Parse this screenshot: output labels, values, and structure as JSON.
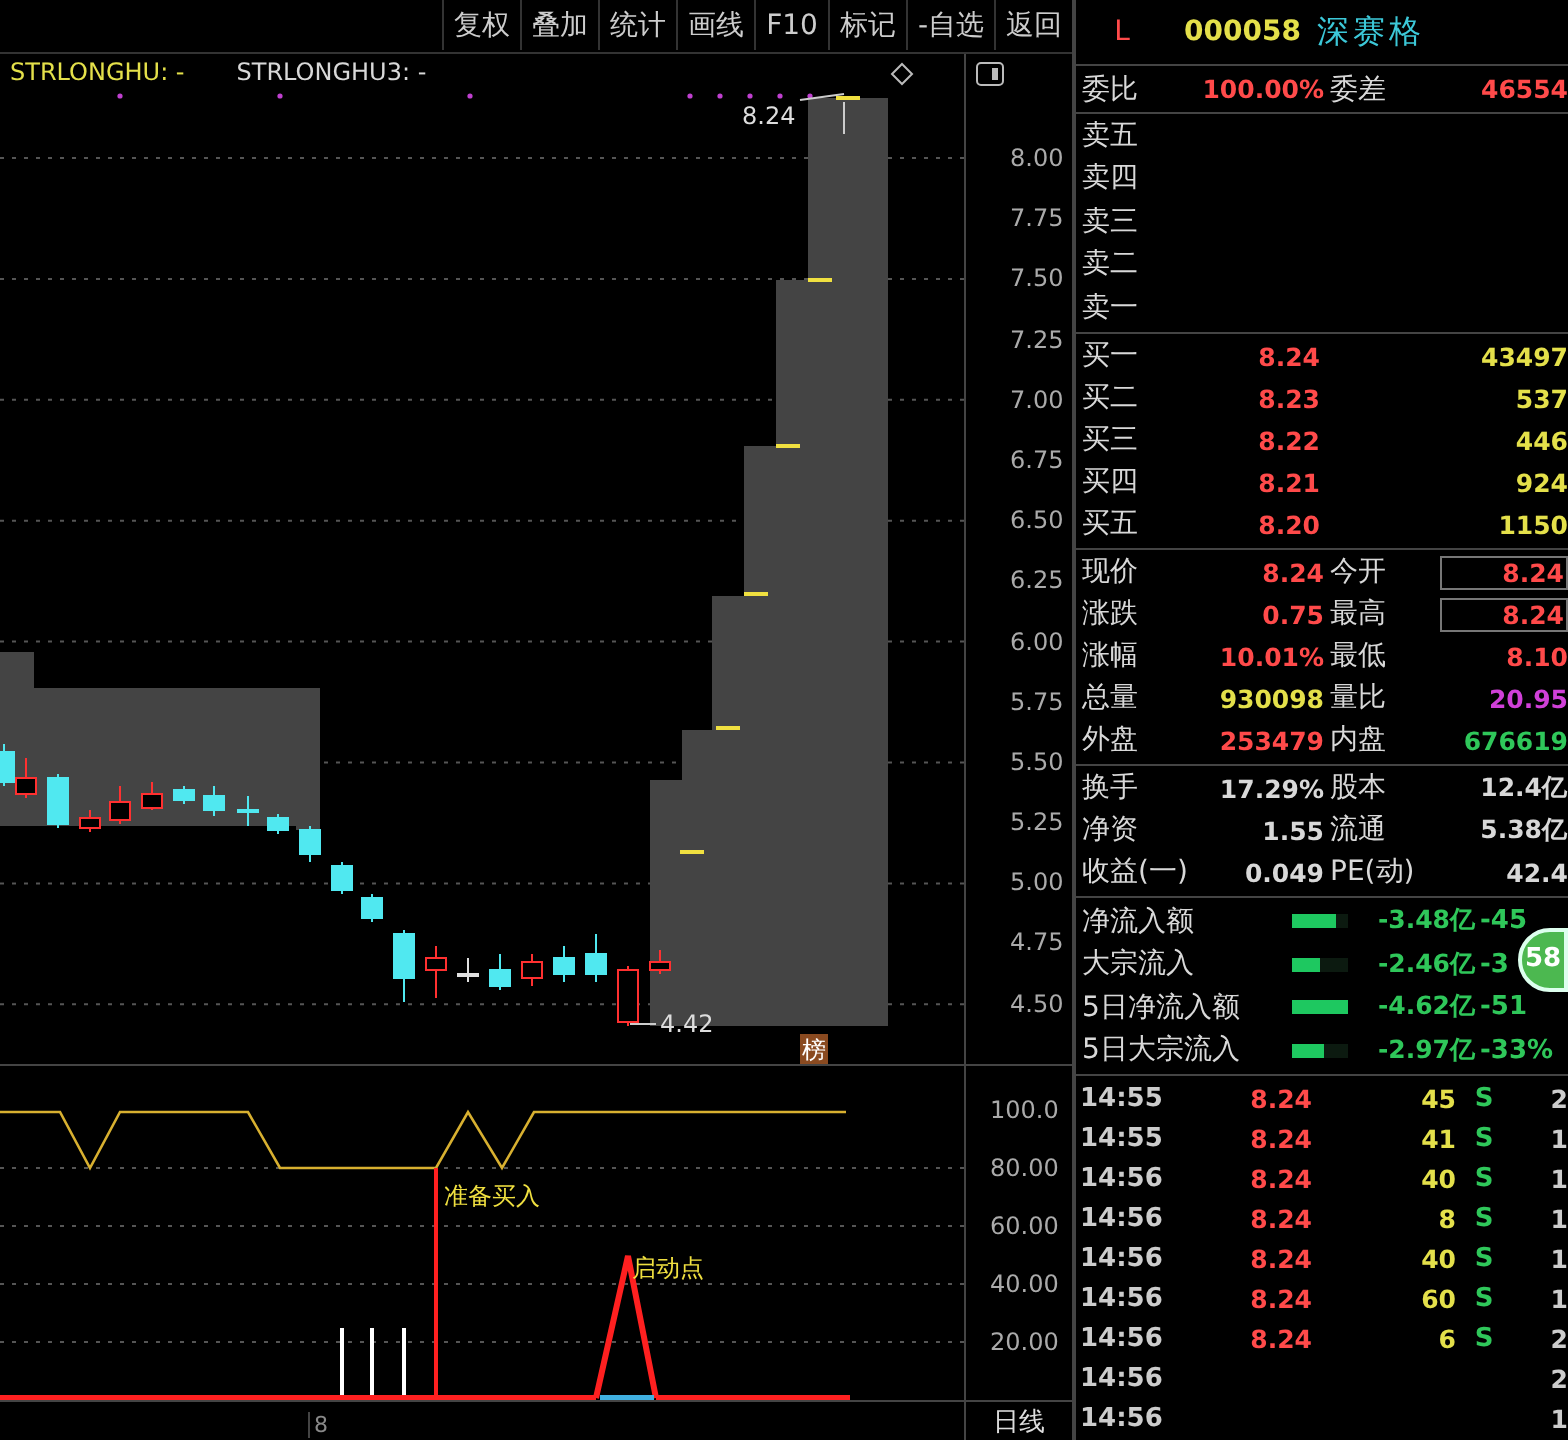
{
  "toolbar": {
    "buttons": [
      "复权",
      "叠加",
      "统计",
      "画线",
      "F10",
      "标记",
      "-自选",
      "返回"
    ]
  },
  "chart": {
    "legend": [
      {
        "text": "STRLONGHU: -",
        "color": "#e4e04a"
      },
      {
        "text": "STRLONGHU3: -",
        "color": "#d8d8d8"
      }
    ],
    "high_label": "8.24",
    "low_label": "4.42",
    "badge": "榜",
    "price_axis": [
      "8.00",
      "7.75",
      "7.50",
      "7.25",
      "7.00",
      "6.75",
      "6.50",
      "6.25",
      "6.00",
      "5.75",
      "5.50",
      "5.25",
      "5.00",
      "4.75",
      "4.50"
    ]
  },
  "indicator": {
    "axis": [
      "100.0",
      "80.00",
      "60.00",
      "40.00",
      "20.00"
    ],
    "buy_signal": "准备买入",
    "start_signal": "启动点"
  },
  "time_axis": {
    "tick": "8",
    "period_tab": "日线"
  },
  "quote": {
    "market": "L",
    "code": "000058",
    "name": "深赛格",
    "ratio": {
      "label": "委比",
      "value": "100.00%",
      "label2": "委差",
      "value2": "46554"
    },
    "sells": [
      "卖五",
      "卖四",
      "卖三",
      "卖二",
      "卖一"
    ],
    "buys": [
      {
        "label": "买一",
        "price": "8.24",
        "volume": "43497"
      },
      {
        "label": "买二",
        "price": "8.23",
        "volume": "537"
      },
      {
        "label": "买三",
        "price": "8.22",
        "volume": "446"
      },
      {
        "label": "买四",
        "price": "8.21",
        "volume": "924"
      },
      {
        "label": "买五",
        "price": "8.20",
        "volume": "1150"
      }
    ],
    "stats": [
      {
        "label": "现价",
        "value": "8.24",
        "color": "#ff4a4a",
        "boxed": false
      },
      {
        "label": "今开",
        "value": "8.24",
        "color": "#ff4a4a",
        "boxed": true
      },
      {
        "label": "涨跌",
        "value": "0.75",
        "color": "#ff4a4a",
        "boxed": false
      },
      {
        "label": "最高",
        "value": "8.24",
        "color": "#ff4a4a",
        "boxed": true
      },
      {
        "label": "涨幅",
        "value": "10.01%",
        "color": "#ff4a4a",
        "boxed": false
      },
      {
        "label": "最低",
        "value": "8.10",
        "color": "#ff4a4a",
        "boxed": false
      },
      {
        "label": "总量",
        "value": "930098",
        "color": "#e4e04a",
        "boxed": false
      },
      {
        "label": "量比",
        "value": "20.95",
        "color": "#d040d8",
        "boxed": false
      },
      {
        "label": "外盘",
        "value": "253479",
        "color": "#ff4a4a",
        "boxed": false
      },
      {
        "label": "内盘",
        "value": "676619",
        "color": "#2fc75a",
        "boxed": false
      }
    ],
    "finance": [
      {
        "label": "换手",
        "value": "17.29%",
        "label2": "股本",
        "value2": "12.4亿"
      },
      {
        "label": "净资",
        "value": "1.55",
        "label2": "流通",
        "value2": "5.38亿"
      },
      {
        "label": "收益(一)",
        "value": "0.049",
        "label2": "PE(动)",
        "value2": "42.4"
      }
    ],
    "flows": [
      {
        "label": "净流入额",
        "level": 0.77,
        "value": "-3.48亿",
        "pct": "-45"
      },
      {
        "label": "大宗流入",
        "level": 0.51,
        "value": "-2.46亿",
        "pct": "-3"
      },
      {
        "label": "5日净流入额",
        "level": 1,
        "value": "-4.62亿",
        "pct": "-51"
      },
      {
        "label": "5日大宗流入",
        "level": 0.58,
        "value": "-2.97亿",
        "pct": "-33%"
      }
    ],
    "float_badge": "58",
    "trades": [
      {
        "time": "14:55",
        "price": "8.24",
        "volume": "45",
        "side": "S",
        "count": "2"
      },
      {
        "time": "14:55",
        "price": "8.24",
        "volume": "41",
        "side": "S",
        "count": "1"
      },
      {
        "time": "14:56",
        "price": "8.24",
        "volume": "40",
        "side": "S",
        "count": "1"
      },
      {
        "time": "14:56",
        "price": "8.24",
        "volume": "8",
        "side": "S",
        "count": "1"
      },
      {
        "time": "14:56",
        "price": "8.24",
        "volume": "40",
        "side": "S",
        "count": "1"
      },
      {
        "time": "14:56",
        "price": "8.24",
        "volume": "60",
        "side": "S",
        "count": "1"
      },
      {
        "time": "14:56",
        "price": "8.24",
        "volume": "6",
        "side": "S",
        "count": "2"
      },
      {
        "time": "14:56",
        "count": "2"
      },
      {
        "time": "14:56",
        "count": "1"
      }
    ]
  }
}
